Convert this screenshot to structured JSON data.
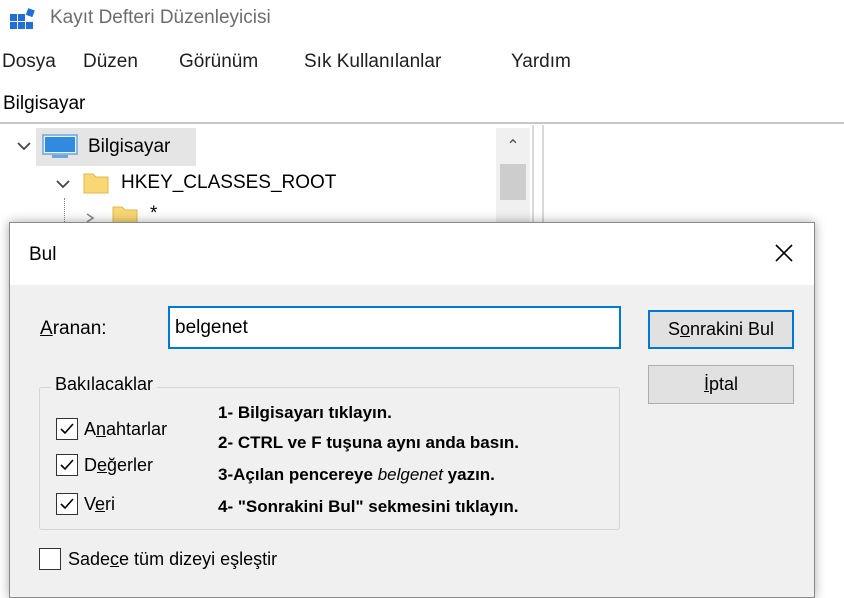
{
  "window": {
    "title": "Kayıt Defteri Düzenleyicisi"
  },
  "menu": [
    {
      "label": "Dosya"
    },
    {
      "label": "Düzen"
    },
    {
      "label": "Görünüm"
    },
    {
      "label": "Sık Kullanılanlar"
    },
    {
      "label": "Yardım"
    }
  ],
  "address": "Bilgisayar",
  "tree": {
    "root_label": "Bilgisayar",
    "hive_label": "HKEY_CLASSES_ROOT",
    "child_label": "*"
  },
  "dialog": {
    "title": "Bul",
    "search": {
      "label_pre": "",
      "label_ul": "A",
      "label_post": "ranan:",
      "value": "belgenet"
    },
    "find_next": {
      "pre": "S",
      "ul": "o",
      "post": "nrakini Bul"
    },
    "cancel": {
      "pre": "",
      "ul": "İ",
      "post": "ptal"
    },
    "look_at": {
      "title": "Bakılacaklar",
      "keys": {
        "pre": "A",
        "ul": "n",
        "post": "ahtarlar",
        "checked": true
      },
      "values": {
        "pre": "D",
        "ul": "e",
        "post": "ğerler",
        "checked": true
      },
      "data": {
        "pre": "V",
        "ul": "e",
        "post": "ri",
        "checked": true
      }
    },
    "match_whole": {
      "pre": "Sade",
      "ul": "c",
      "post": "e tüm dizeyi eşleştir",
      "checked": false
    }
  },
  "instructions": {
    "line1": "1- Bilgisayarı tıklayın.",
    "line2": "2- CTRL ve F tuşuna aynı anda basın.",
    "line3_pre": "3-Açılan pencereye ",
    "line3_em": "belgenet",
    "line3_post": " yazın.",
    "line4": "4- \"Sonrakini Bul\" sekmesini tıklayın."
  },
  "colors": {
    "accent": "#0078d7",
    "dialog_bg": "#f0f0f0",
    "folder": "#f8d775"
  }
}
